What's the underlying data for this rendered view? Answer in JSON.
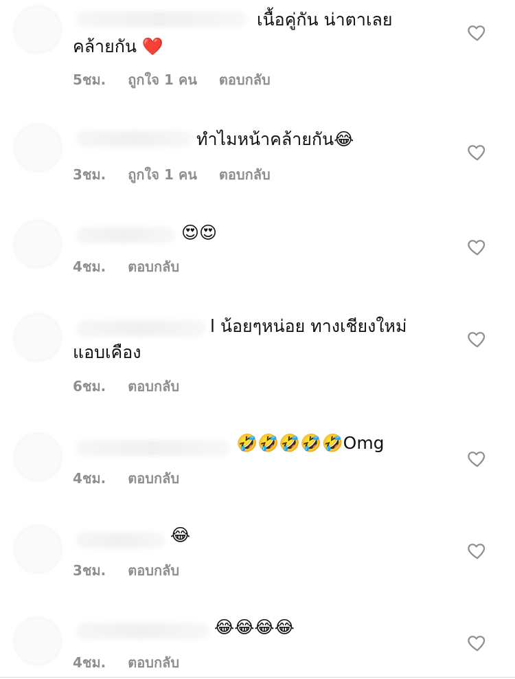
{
  "comments": [
    {
      "line1": "เนื้อคู่กัน น่าตาเลย",
      "line2": "คล้ายกัน ❤️",
      "time": "5ชม.",
      "likes": "ถูกใจ 1 คน",
      "reply": "ตอบกลับ"
    },
    {
      "line1": "ทำไมหน้าคล้ายกัน😂",
      "time": "3ชม.",
      "likes": "ถูกใจ 1 คน",
      "reply": "ตอบกลับ"
    },
    {
      "line1": "😍😍",
      "time": "4ชม.",
      "reply": "ตอบกลับ"
    },
    {
      "line1": "l น้อยๆหน่อย ทางเชียงใหม่",
      "line2": "แอบเคือง",
      "time": "6ชม.",
      "reply": "ตอบกลับ"
    },
    {
      "line1": "🤣🤣🤣🤣🤣Omg",
      "time": "4ชม.",
      "reply": "ตอบกลับ"
    },
    {
      "line1": "😂",
      "time": "3ชม.",
      "reply": "ตอบกลับ"
    },
    {
      "line1": "😂😂😂😂",
      "time": "4ชม.",
      "reply": "ตอบกลับ"
    }
  ],
  "icons": {
    "like": "heart-outline-icon"
  },
  "colors": {
    "meta": "#8e8e8e",
    "heart_stroke": "#8e8e8e"
  }
}
